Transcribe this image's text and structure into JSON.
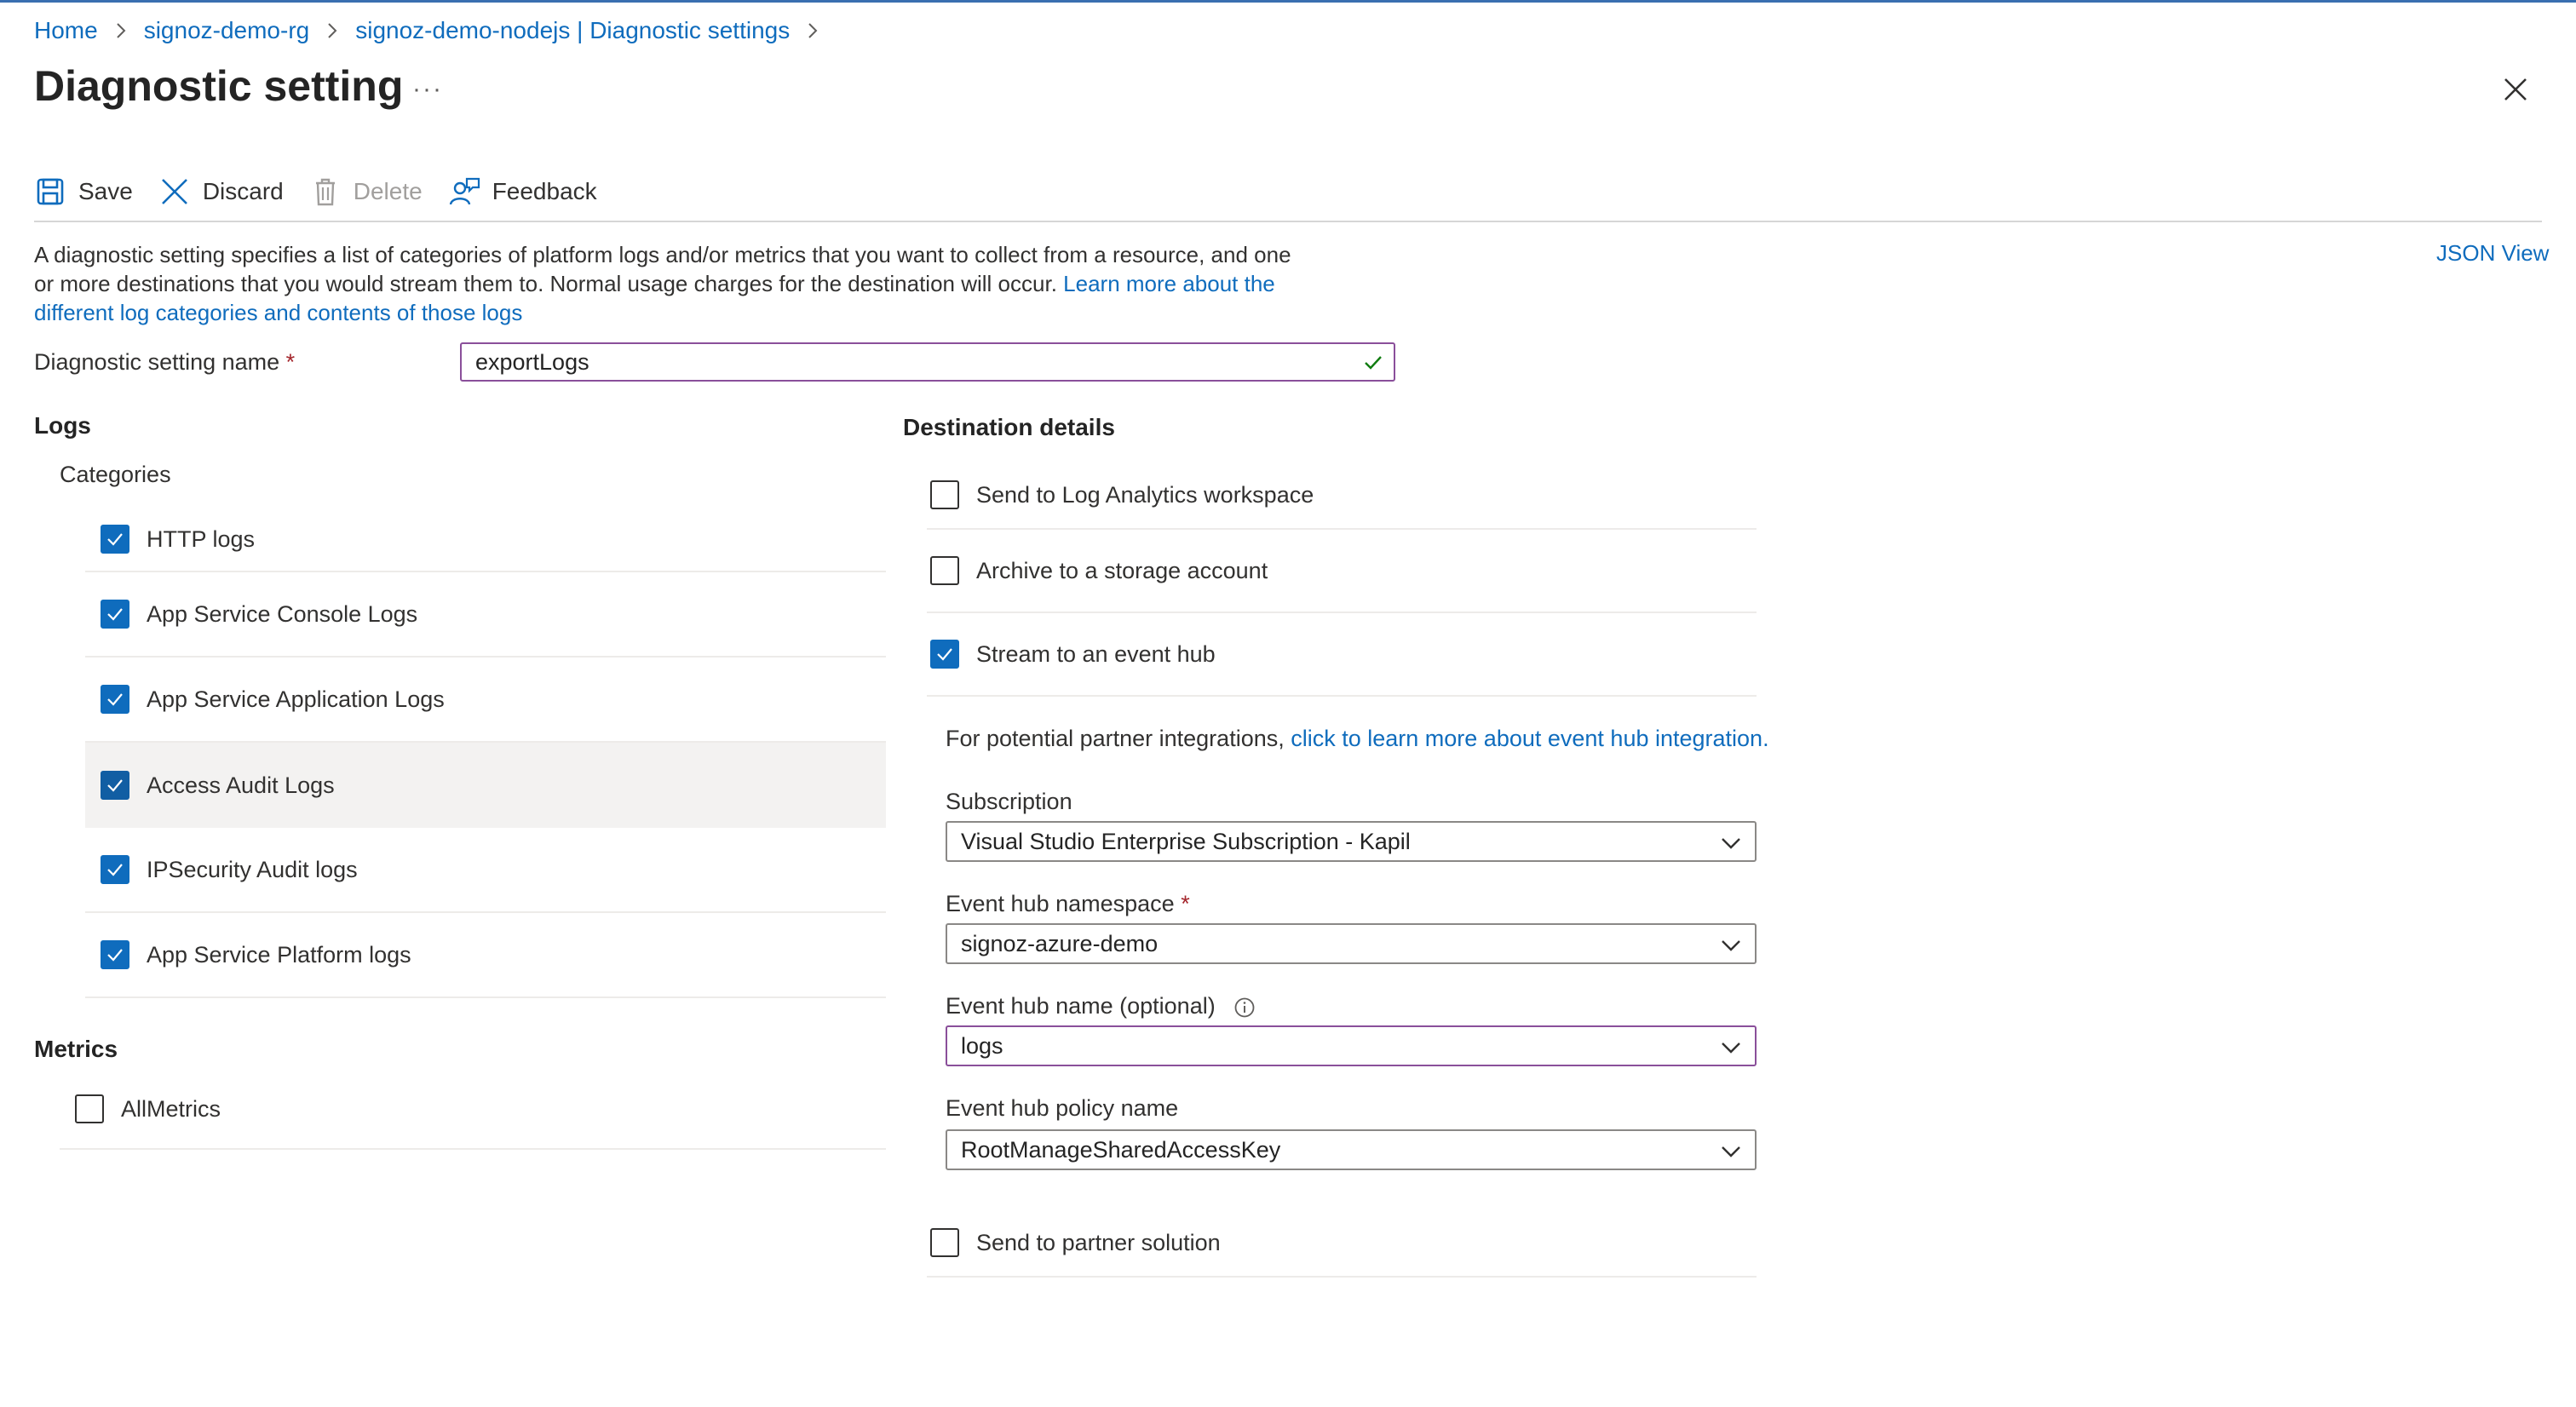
{
  "breadcrumb": [
    "Home",
    "signoz-demo-rg",
    "signoz-demo-nodejs | Diagnostic settings"
  ],
  "page_title": "Diagnostic setting",
  "more_label": "···",
  "toolbar": {
    "save": "Save",
    "discard": "Discard",
    "delete": "Delete",
    "feedback": "Feedback"
  },
  "description": {
    "text": "A diagnostic setting specifies a list of categories of platform logs and/or metrics that you want to collect from a resource, and one or more destinations that you would stream them to. Normal usage charges for the destination will occur. ",
    "link": "Learn more about the different log categories and contents of those logs"
  },
  "json_view": "JSON View",
  "setting_name": {
    "label": "Diagnostic setting name",
    "required_mark": "*",
    "value": "exportLogs"
  },
  "logs": {
    "title": "Logs",
    "categories_label": "Categories",
    "items": [
      {
        "label": "HTTP logs",
        "checked": true
      },
      {
        "label": "App Service Console Logs",
        "checked": true
      },
      {
        "label": "App Service Application Logs",
        "checked": true
      },
      {
        "label": "Access Audit Logs",
        "checked": true
      },
      {
        "label": "IPSecurity Audit logs",
        "checked": true
      },
      {
        "label": "App Service Platform logs",
        "checked": true
      }
    ]
  },
  "metrics": {
    "title": "Metrics",
    "items": [
      {
        "label": "AllMetrics",
        "checked": false
      }
    ]
  },
  "destination": {
    "title": "Destination details",
    "options": [
      {
        "label": "Send to Log Analytics workspace",
        "checked": false
      },
      {
        "label": "Archive to a storage account",
        "checked": false
      },
      {
        "label": "Stream to an event hub",
        "checked": true
      }
    ],
    "partner_text": "For potential partner integrations, ",
    "partner_link": "click to learn more about event hub integration.",
    "subscription": {
      "label": "Subscription",
      "value": "Visual Studio Enterprise Subscription - Kapil"
    },
    "namespace": {
      "label": "Event hub namespace",
      "required_mark": "*",
      "value": "signoz-azure-demo"
    },
    "hub_name": {
      "label": "Event hub name (optional)",
      "value": "logs"
    },
    "policy": {
      "label": "Event hub policy name",
      "value": "RootManageSharedAccessKey"
    },
    "partner_solution": {
      "label": "Send to partner solution",
      "checked": false
    }
  },
  "colors": {
    "accent": "#0f6cbd",
    "focus_border": "#8a4f9a",
    "required": "#a4262c"
  }
}
